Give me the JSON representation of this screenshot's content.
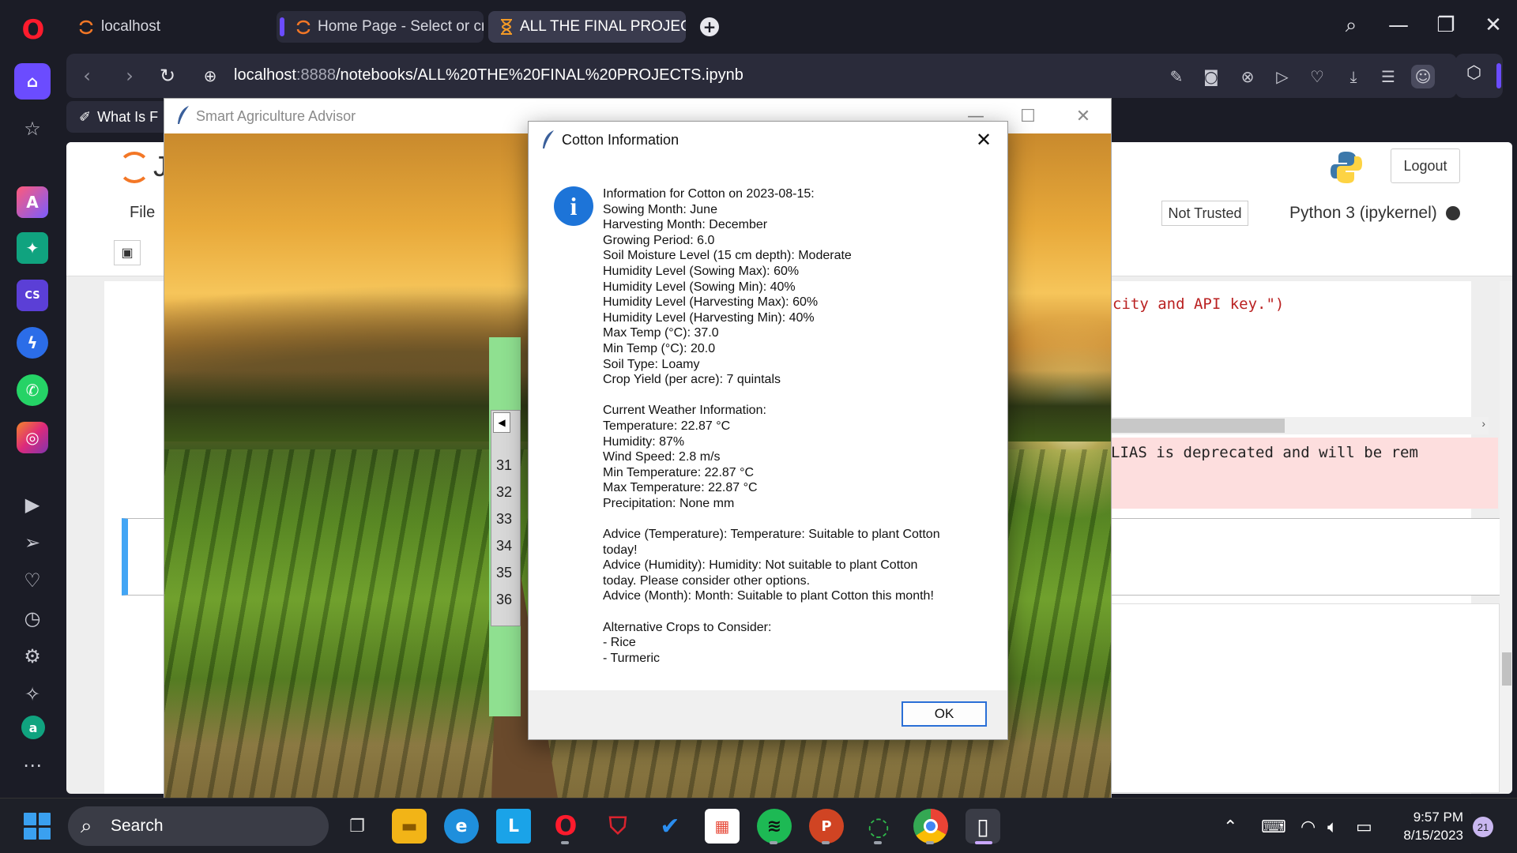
{
  "browser": {
    "tabs": [
      {
        "label": "localhost"
      },
      {
        "label": "Home Page - Select or cre"
      },
      {
        "label": "ALL THE FINAL PROJECTS"
      }
    ],
    "url_host": "localhost",
    "url_port": ":8888",
    "url_path": "/notebooks/ALL%20THE%20FINAL%20PROJECTS.ipynb",
    "bookmark_label": "What Is F",
    "accent_color": "#6b4cff"
  },
  "notebook": {
    "logo_letter": "J",
    "logout_label": "Logout",
    "menu_file": "File",
    "trusted_label": "Not Trusted",
    "kernel_label": "Python 3 (ipykernel)",
    "code_fragment": "city and API key.\")",
    "warning_fragment": "LIAS is deprecated and will be rem"
  },
  "tk_window": {
    "title": "Smart Agriculture Advisor",
    "row_numbers": [
      "31",
      "32",
      "33",
      "34",
      "35",
      "36"
    ],
    "panel_color": "#8fe090"
  },
  "dialog": {
    "title": "Cotton Information",
    "ok_label": "OK",
    "lines": [
      "Information for Cotton on 2023-08-15:",
      "Sowing Month: June",
      "Harvesting Month: December",
      "Growing Period: 6.0",
      "Soil Moisture Level (15 cm depth): Moderate",
      "Humidity Level (Sowing Max): 60%",
      "Humidity Level (Sowing Min): 40%",
      "Humidity Level (Harvesting Max): 60%",
      "Humidity Level (Harvesting Min): 40%",
      "Max Temp (°C): 37.0",
      "Min Temp (°C): 20.0",
      "Soil Type: Loamy",
      "Crop Yield (per acre): 7 quintals",
      "",
      "Current Weather Information:",
      "Temperature: 22.87 °C",
      "Humidity: 87%",
      "Wind Speed: 2.8 m/s",
      "Min Temperature: 22.87 °C",
      "Max Temperature: 22.87 °C",
      "Precipitation: None mm",
      "",
      "Advice (Temperature): Temperature: Suitable to plant Cotton",
      "today!",
      "Advice (Humidity): Humidity: Not suitable to plant Cotton",
      "today. Please consider other options.",
      "Advice (Month): Month: Suitable to plant Cotton this month!",
      "",
      "Alternative Crops to Consider:",
      "- Rice",
      "- Turmeric"
    ]
  },
  "taskbar": {
    "search_label": "Search",
    "time": "9:57 PM",
    "date": "8/15/2023",
    "notification_count": "21"
  }
}
